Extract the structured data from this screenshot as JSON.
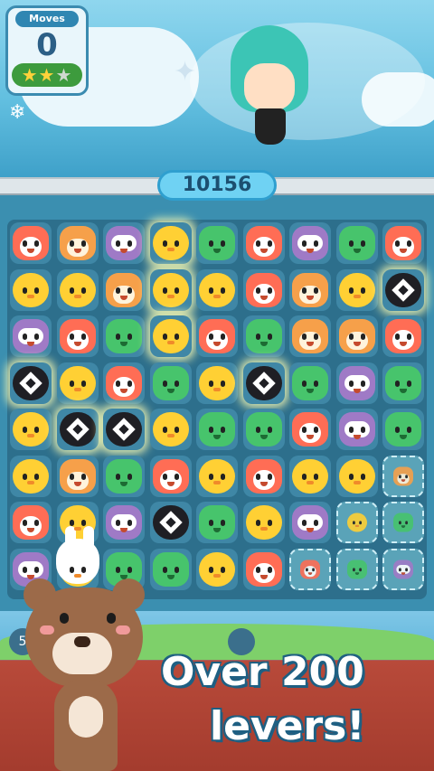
{
  "hud": {
    "moves_label": "Moves",
    "moves_value": "0",
    "stars_filled": 2,
    "stars_total": 3,
    "score": "10156"
  },
  "boosters": {
    "left_badge": "5"
  },
  "banner": {
    "line1": "Over 200",
    "line2": "levers!"
  },
  "board": {
    "cols": 9,
    "rows": 8,
    "grid": [
      [
        "fox",
        "tiger",
        "owl",
        "chick",
        "frog",
        "fox",
        "owl",
        "frog",
        "fox"
      ],
      [
        "chick",
        "chick",
        "tiger",
        "chick",
        "chick",
        "fox",
        "tiger",
        "chick",
        "bomb"
      ],
      [
        "owl",
        "fox",
        "frog",
        "chick",
        "fox",
        "frog",
        "tiger",
        "tiger",
        "fox"
      ],
      [
        "bomb",
        "chick",
        "fox",
        "frog",
        "chick",
        "bomb",
        "frog",
        "owl",
        "frog"
      ],
      [
        "chick",
        "bomb",
        "bomb",
        "chick",
        "frog",
        "frog",
        "fox",
        "owl",
        "frog"
      ],
      [
        "chick",
        "tiger",
        "frog",
        "fox",
        "chick",
        "fox",
        "chick",
        "chick",
        "frozen-tiger"
      ],
      [
        "fox",
        "chick",
        "owl",
        "bomb",
        "frog",
        "chick",
        "owl",
        "frozen-chick",
        "frozen-frog"
      ],
      [
        "owl",
        "chick",
        "frog",
        "frog",
        "chick",
        "fox",
        "frozen-fox",
        "frozen-frog",
        "frozen-owl"
      ]
    ],
    "glowing": [
      "0-3",
      "1-3",
      "2-3",
      "1-8",
      "3-0",
      "3-5",
      "4-1",
      "4-2"
    ]
  },
  "colors": {
    "fox": "#ff6d55",
    "tiger": "#f6a04a",
    "owl": "#9f7ac6",
    "chick": "#ffd034",
    "frog": "#47c46c",
    "bomb": "#1f1f24"
  }
}
